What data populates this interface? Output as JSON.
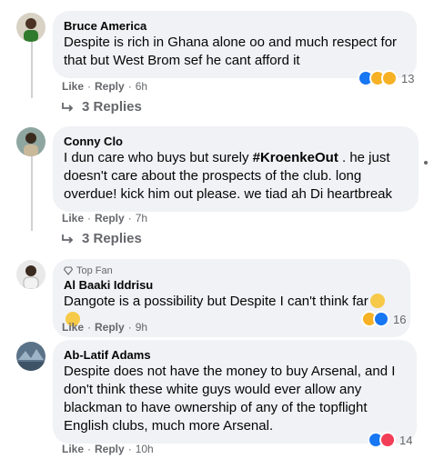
{
  "comments": [
    {
      "author": "Bruce America",
      "text": "Despite is rich in Ghana alone oo and much respect for that but West Brom sef he cant afford it",
      "like_label": "Like",
      "reply_label": "Reply",
      "time": "6h",
      "reaction_count": "13",
      "reaction_icons": [
        "like-icon",
        "wow-icon",
        "haha-icon"
      ],
      "replies_label": "3 Replies"
    },
    {
      "author": "Conny Clo",
      "text_before": "I dun care who buys but surely ",
      "hashtag": "#KroenkeOut",
      "text_after": " . he just doesn't care about the prospects of the club. long overdue! kick him out please. we tiad ah Di heartbreak",
      "like_label": "Like",
      "reply_label": "Reply",
      "time": "7h",
      "replies_label": "3 Replies"
    },
    {
      "badge": "Top Fan",
      "author": "Al Baaki Iddrisu",
      "text": "Dangote is a possibility but Despite I can't think far",
      "like_label": "Like",
      "reply_label": "Reply",
      "time": "9h",
      "reaction_count": "16",
      "reaction_icons": [
        "haha-icon",
        "like-icon"
      ]
    },
    {
      "author": "Ab-Latif Adams",
      "text": "Despite does not have the money to buy Arsenal, and I don't think these white guys would ever allow any blackman to have ownership of any of the topflight English clubs, much more Arsenal.",
      "like_label": "Like",
      "reply_label": "Reply",
      "time": "10h",
      "reaction_count": "14",
      "reaction_icons": [
        "like-icon",
        "love-icon"
      ]
    }
  ],
  "separator": "·",
  "colors": {
    "bubble": "#f0f2f5",
    "meta": "#65676b",
    "like": "#1877f2",
    "love": "#f33e58",
    "haha": "#f7b125"
  }
}
